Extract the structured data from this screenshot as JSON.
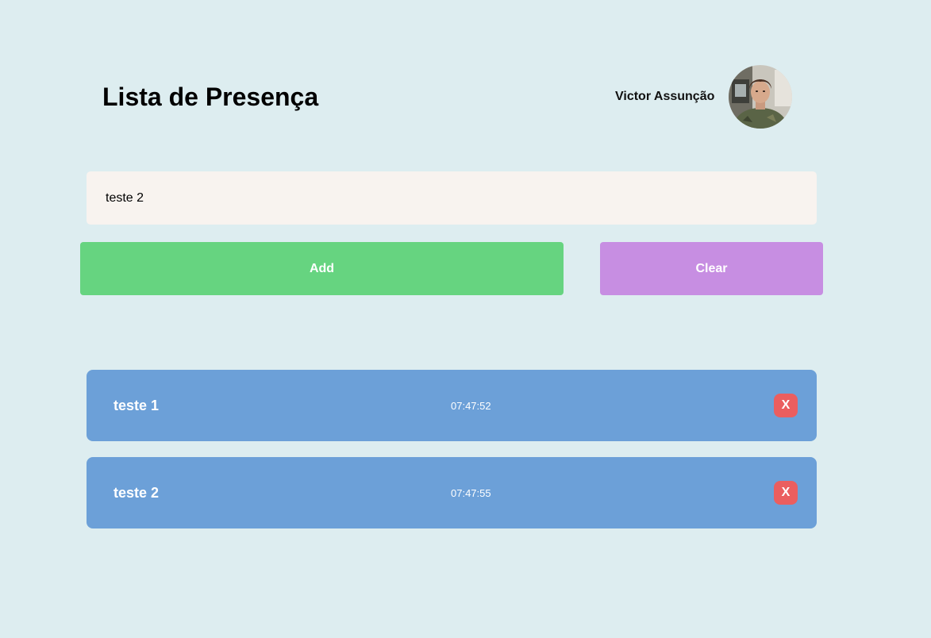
{
  "header": {
    "title": "Lista de Presença",
    "user_name": "Victor Assunção",
    "avatar_icon": "user-photo"
  },
  "form": {
    "input_value": "teste 2",
    "add_label": "Add",
    "clear_label": "Clear"
  },
  "attendees": [
    {
      "name": "teste 1",
      "time": "07:47:52",
      "remove_label": "X"
    },
    {
      "name": "teste 2",
      "time": "07:47:55",
      "remove_label": "X"
    }
  ],
  "colors": {
    "background": "#ddedf0",
    "input_background": "#f8f3ef",
    "add_button": "#66d480",
    "clear_button": "#c78ee2",
    "list_item": "#6ca0d8",
    "remove_button": "#eb5e5f"
  }
}
